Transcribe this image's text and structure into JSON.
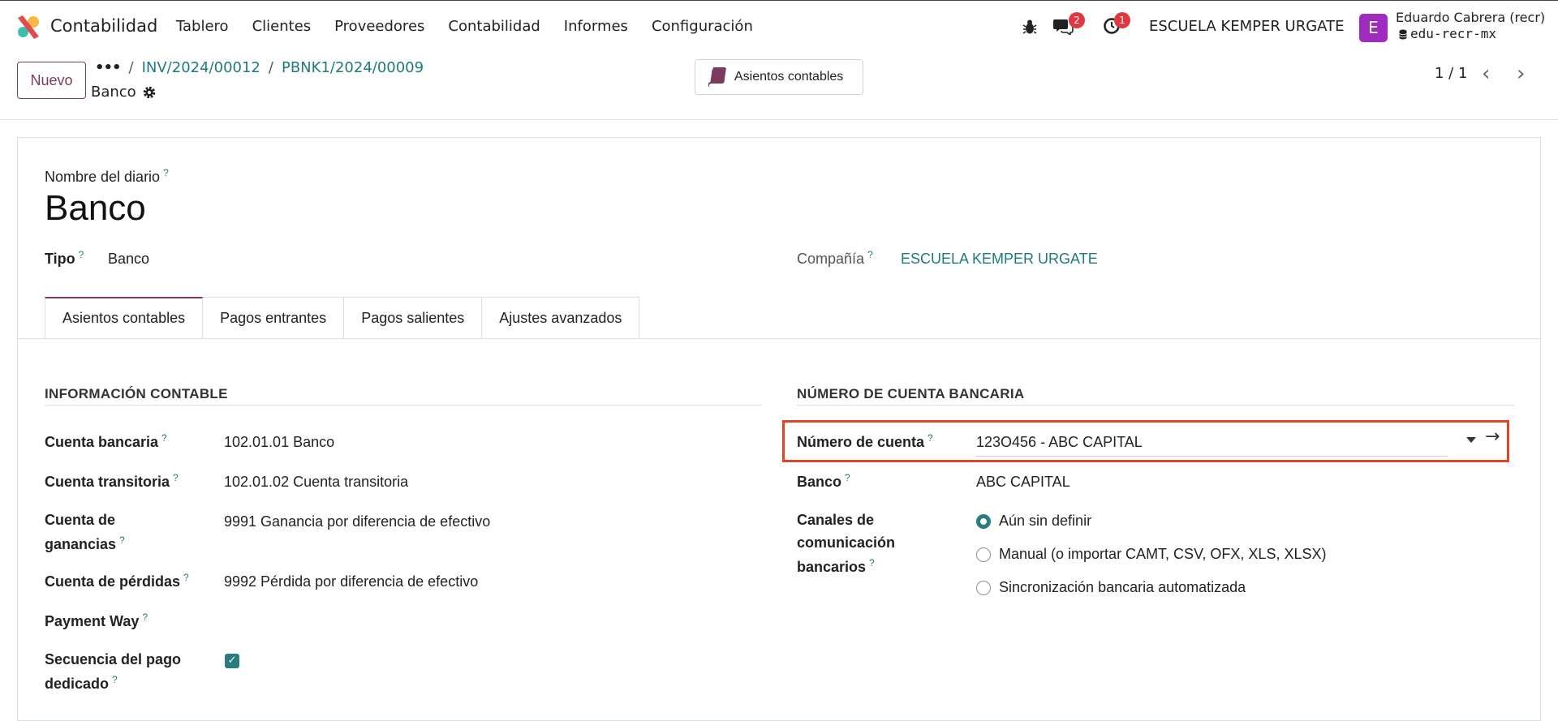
{
  "app": {
    "name": "Contabilidad"
  },
  "menu": [
    "Tablero",
    "Clientes",
    "Proveedores",
    "Contabilidad",
    "Informes",
    "Configuración"
  ],
  "systray": {
    "messages_count": "2",
    "activities_count": "1",
    "company": "ESCUELA KEMPER URGATE",
    "avatar_letter": "E",
    "user_name": "Eduardo Cabrera (recr)",
    "database": "edu-recr-mx"
  },
  "control_panel": {
    "new_button": "Nuevo",
    "breadcrumb": [
      "INV/2024/00012",
      "PBNK1/2024/00009"
    ],
    "record_title": "Banco",
    "smart_button": "Asientos contables",
    "pager": "1 / 1"
  },
  "form": {
    "journal_name_label": "Nombre del diario",
    "journal_name": "Banco",
    "type_label": "Tipo",
    "type_value": "Banco",
    "company_label": "Compañía",
    "company_value": "ESCUELA KEMPER URGATE",
    "help_mark": "?",
    "tabs": [
      "Asientos contables",
      "Pagos entrantes",
      "Pagos salientes",
      "Ajustes avanzados"
    ],
    "accounting_section": {
      "title": "INFORMACIÓN CONTABLE",
      "bank_account_label": "Cuenta bancaria",
      "bank_account_value": "102.01.01 Banco",
      "suspense_label": "Cuenta transitoria",
      "suspense_value": "102.01.02 Cuenta transitoria",
      "profit_label_1": "Cuenta de",
      "profit_label_2": "ganancias",
      "profit_value": "9991 Ganancia por diferencia de efectivo",
      "loss_label": "Cuenta de pérdidas",
      "loss_value": "9992 Pérdida por diferencia de efectivo",
      "payment_way_label": "Payment Way",
      "dedicated_seq_label_1": "Secuencia del pago",
      "dedicated_seq_label_2": "dedicado",
      "dedicated_seq_checked": true
    },
    "bank_section": {
      "title": "NÚMERO DE CUENTA BANCARIA",
      "account_number_label": "Número de cuenta",
      "account_number_value": "123O456 - ABC CAPITAL",
      "bank_label": "Banco",
      "bank_value": "ABC CAPITAL",
      "feeds_label_1": "Canales de",
      "feeds_label_2": "comunicación",
      "feeds_label_3": "bancarios",
      "feeds_options": [
        "Aún sin definir",
        "Manual (o importar CAMT, CSV, OFX, XLS, XLSX)",
        "Sincronización bancaria automatizada"
      ],
      "feeds_selected": 0
    }
  },
  "colors": {
    "accent": "#7c3a5f",
    "teal": "#2a7c80",
    "highlight": "#e0442a"
  }
}
